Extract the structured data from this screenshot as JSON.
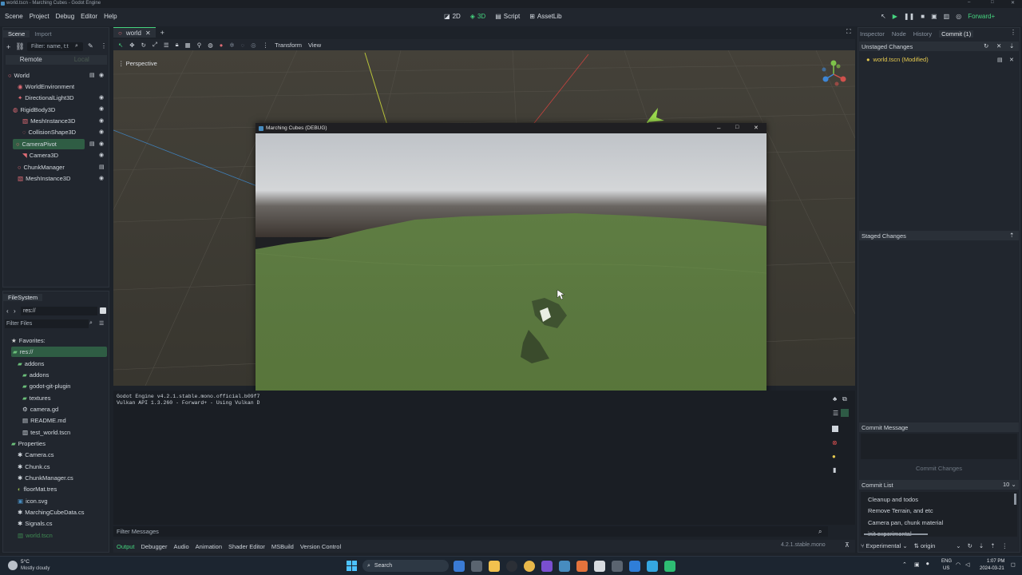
{
  "window": {
    "title": "world.tscn - Marching Cubes - Godot Engine"
  },
  "menu": [
    "Scene",
    "Project",
    "Debug",
    "Editor",
    "Help"
  ],
  "workspaces": {
    "twod": "2D",
    "threed": "3D",
    "script": "Script",
    "assetlib": "AssetLib"
  },
  "renderer": "Forward+",
  "scene_dock": {
    "tabs": [
      "Scene",
      "Import"
    ],
    "filter_placeholder": "Filter: name, t:t",
    "remote": "Remote",
    "local": "Local",
    "nodes": [
      {
        "label": "World"
      },
      {
        "label": "WorldEnvironment"
      },
      {
        "label": "DirectionalLight3D"
      },
      {
        "label": "RigidBody3D"
      },
      {
        "label": "MeshInstance3D"
      },
      {
        "label": "CollisionShape3D"
      },
      {
        "label": "CameraPivot"
      },
      {
        "label": "Camera3D"
      },
      {
        "label": "ChunkManager"
      },
      {
        "label": "MeshInstance3D"
      }
    ]
  },
  "filesystem": {
    "title": "FileSystem",
    "path": "res://",
    "filter_placeholder": "Filter Files",
    "favorites": "Favorites:",
    "items": [
      {
        "label": "res://"
      },
      {
        "label": "addons"
      },
      {
        "label": "addons"
      },
      {
        "label": "godot-git-plugin"
      },
      {
        "label": "textures"
      },
      {
        "label": "camera.gd"
      },
      {
        "label": "README.md"
      },
      {
        "label": "test_world.tscn"
      },
      {
        "label": "Properties"
      },
      {
        "label": "Camera.cs"
      },
      {
        "label": "Chunk.cs"
      },
      {
        "label": "ChunkManager.cs"
      },
      {
        "label": "floorMat.tres"
      },
      {
        "label": "icon.svg"
      },
      {
        "label": "MarchingCubeData.cs"
      },
      {
        "label": "Signals.cs"
      },
      {
        "label": "world.tscn"
      }
    ]
  },
  "editor_tab": "world",
  "viewport": {
    "menus": [
      "Transform",
      "View"
    ],
    "perspective": "Perspective"
  },
  "game_window": {
    "title": "Marching Cubes (DEBUG)"
  },
  "output": {
    "lines": [
      "Godot Engine v4.2.1.stable.mono.official.b09f7",
      "Vulkan API 1.3.260 - Forward+ - Using Vulkan D"
    ],
    "filter_placeholder": "Filter Messages"
  },
  "bottom_tabs": [
    "Output",
    "Debugger",
    "Audio",
    "Animation",
    "Shader Editor",
    "MSBuild",
    "Version Control"
  ],
  "version": "4.2.1.stable.mono",
  "right_dock": {
    "tabs": [
      "Inspector",
      "Node",
      "History",
      "Commit (1)"
    ],
    "unstaged_title": "Unstaged Changes",
    "unstaged_file": "world.tscn (Modified)",
    "staged_title": "Staged Changes",
    "commit_message_title": "Commit Message",
    "commit_button": "Commit Changes",
    "commit_list_title": "Commit List",
    "commit_count": "10",
    "commits": [
      "Cleanup and todos",
      "Remove Terrain, and etc",
      "Camera pan, chunk material",
      "init experimental"
    ],
    "branch": "Experimental",
    "remote": "origin"
  },
  "taskbar": {
    "weather_temp": "5°C",
    "weather_desc": "Mostly cloudy",
    "search": "Search",
    "lang_top": "ENG",
    "lang_bottom": "US",
    "time": "1:07 PM",
    "date": "2024-03-21"
  },
  "colors": {
    "accent": "#45d47f",
    "selection": "#2f5d44",
    "panel": "#21262e",
    "terrain": "#5e7b42",
    "sky": "#c7cace"
  }
}
